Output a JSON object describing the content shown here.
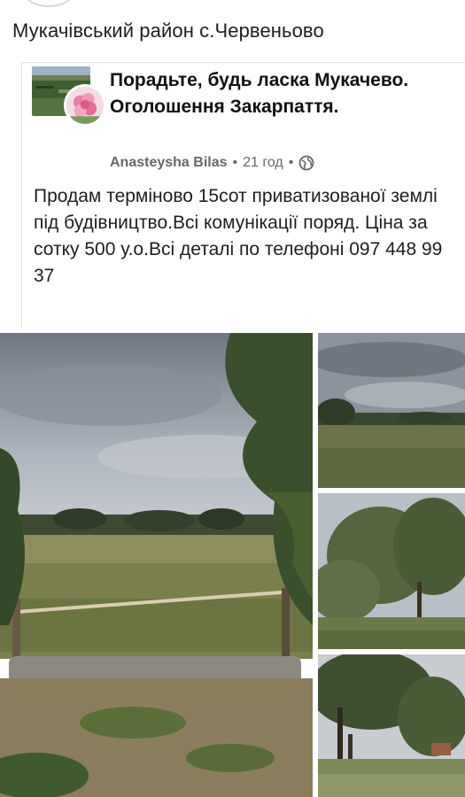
{
  "caption": "Мукачівський район с.Червеньово",
  "post": {
    "group_name": "Порадьте, будь ласка Мукачево. Оголошення Закарпаття.",
    "author": "Anasteysha Bilas",
    "time": "21 год",
    "separator": "•",
    "privacy_icon": "globe-icon",
    "text": "Продам терміново 15сот приватизованої землі під будівництво.Всі комунікації поряд. Ціна за сотку 500 у.о.Всі деталі по телефоні 097 448 99 37"
  },
  "photos": [
    {
      "name": "photo-field-fence",
      "description_icon": "image"
    },
    {
      "name": "photo-field-sky",
      "description_icon": "image"
    },
    {
      "name": "photo-trees",
      "description_icon": "image"
    },
    {
      "name": "photo-tree-house",
      "description_icon": "image"
    }
  ],
  "colors": {
    "text_primary": "#1c1e21",
    "text_secondary": "#65676b",
    "background": "#ffffff"
  }
}
